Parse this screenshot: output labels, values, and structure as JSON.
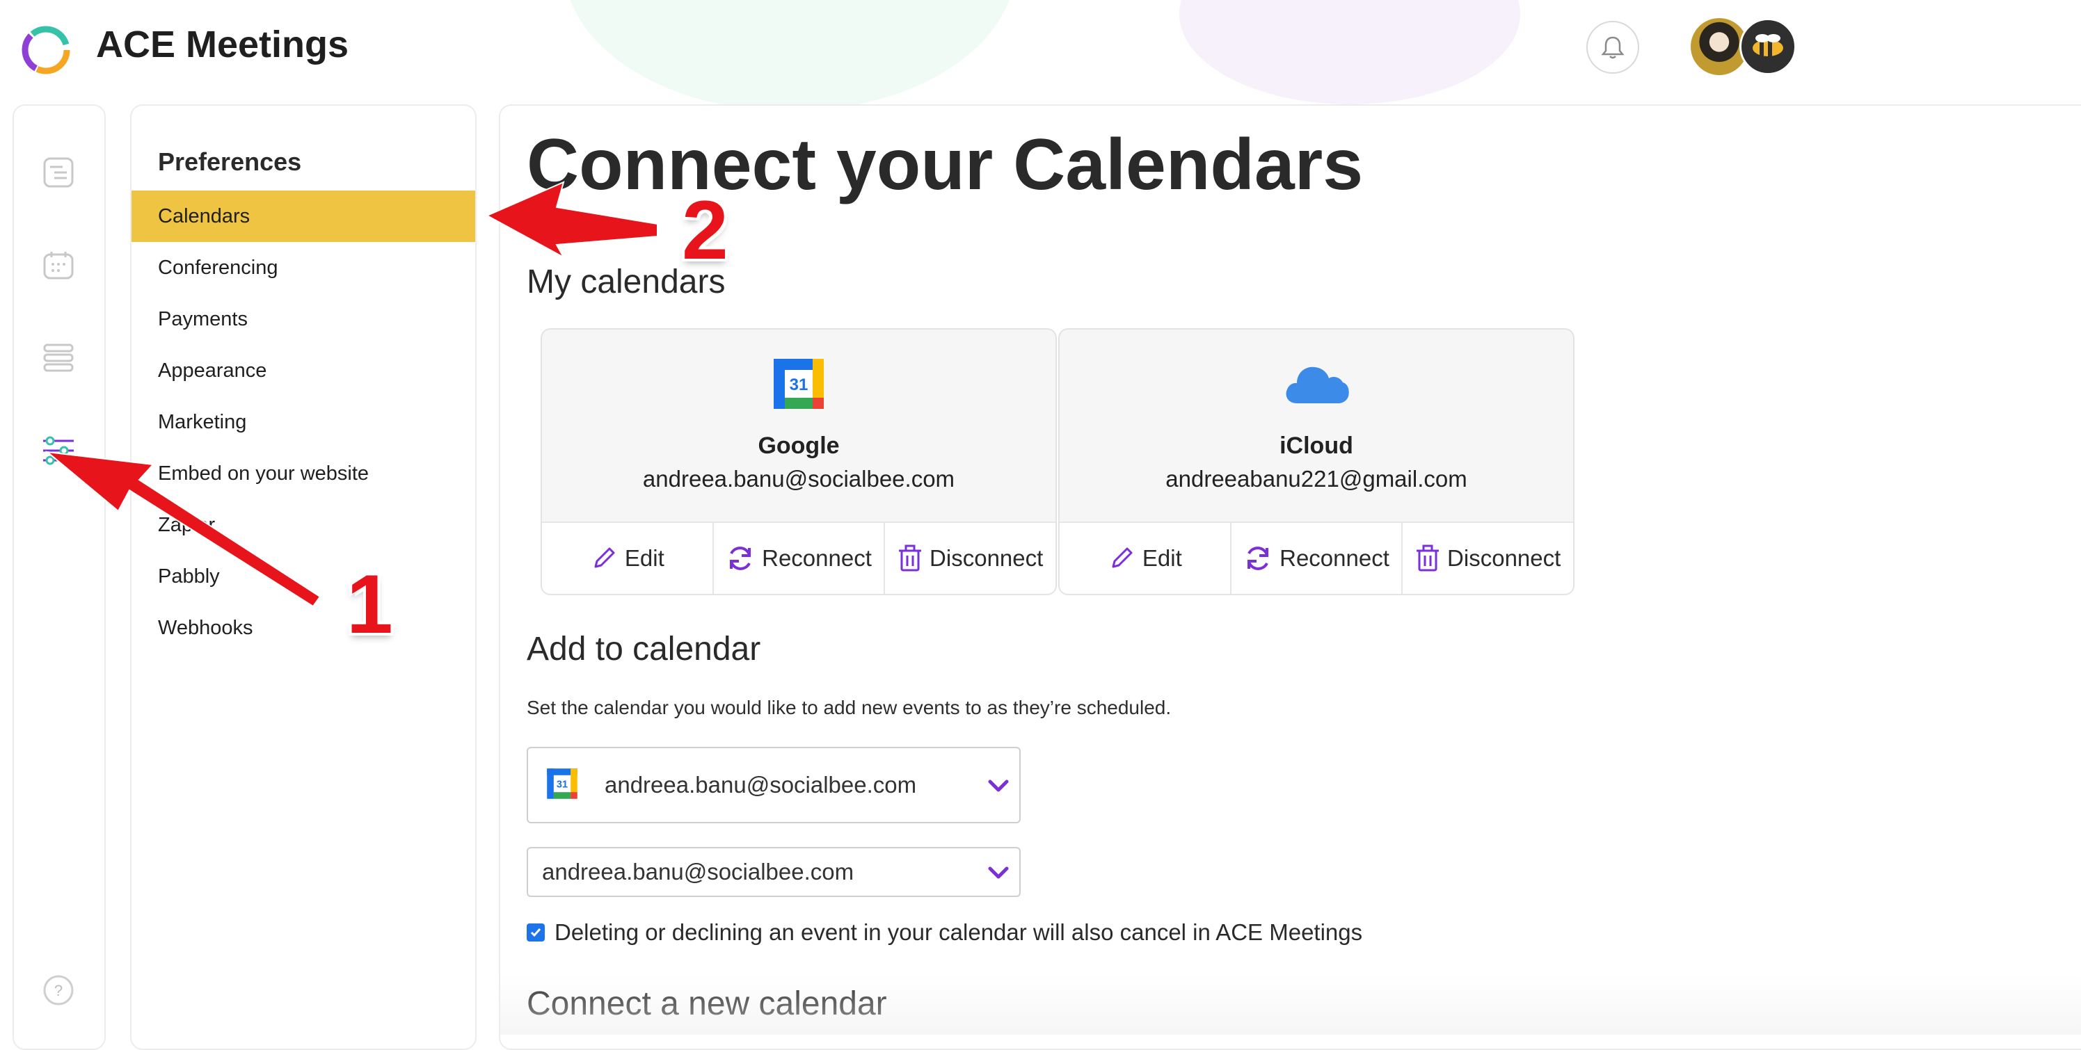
{
  "app": {
    "title": "ACE Meetings"
  },
  "colors": {
    "accent": "#7b2fd6",
    "active_nav": "#f0c443",
    "annotation": "#e8141b"
  },
  "icons": {
    "logo": "ace-logo",
    "notifications": "bell-icon",
    "rail": [
      "list-doc-icon",
      "calendar-grid-icon",
      "stack-icon",
      "sliders-icon",
      "help-icon"
    ]
  },
  "preferences": {
    "title": "Preferences",
    "items": [
      {
        "label": "Calendars"
      },
      {
        "label": "Conferencing"
      },
      {
        "label": "Payments"
      },
      {
        "label": "Appearance"
      },
      {
        "label": "Marketing"
      },
      {
        "label": "Embed on your website"
      },
      {
        "label": "Zapier"
      },
      {
        "label": "Pabbly"
      },
      {
        "label": "Webhooks"
      }
    ]
  },
  "main": {
    "title": "Connect your Calendars",
    "my_calendars": {
      "heading": "My calendars",
      "cards": [
        {
          "provider": "Google",
          "email": "andreea.banu@socialbee.com",
          "actions": [
            "Edit",
            "Reconnect",
            "Disconnect"
          ]
        },
        {
          "provider": "iCloud",
          "email": "andreeabanu221@gmail.com",
          "actions": [
            "Edit",
            "Reconnect",
            "Disconnect"
          ]
        }
      ]
    },
    "add_to_calendar": {
      "heading": "Add to calendar",
      "description": "Set the calendar you would like to add new events to as they’re scheduled.",
      "account_select": "andreea.banu@socialbee.com",
      "calendar_select": "andreea.banu@socialbee.com",
      "checkbox_label": "Deleting or declining an event in your calendar will also cancel in ACE Meetings",
      "checkbox_checked": true
    },
    "connect_new": {
      "heading": "Connect a new calendar"
    }
  },
  "annotations": {
    "step1": "1",
    "step2": "2"
  }
}
